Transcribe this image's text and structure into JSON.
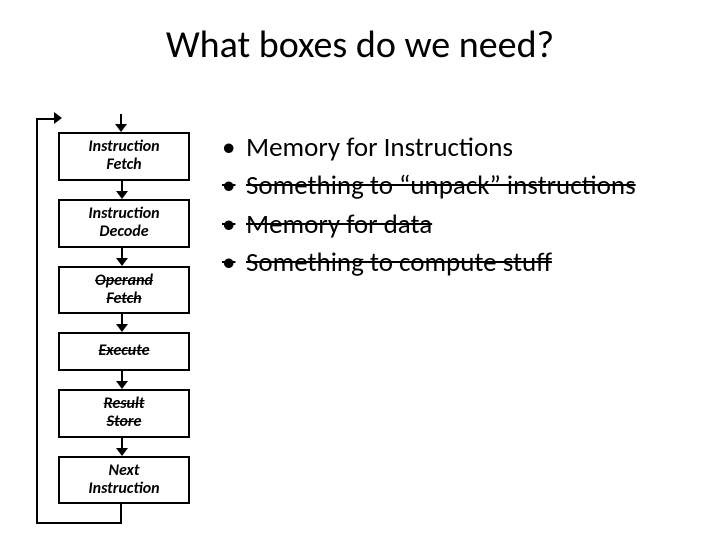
{
  "title": "What boxes do we need?",
  "flow": {
    "stages": [
      {
        "line1": "Instruction",
        "line2": "Fetch",
        "struck": false
      },
      {
        "line1": "Instruction",
        "line2": "Decode",
        "struck": false
      },
      {
        "line1": "Operand",
        "line2": "Fetch",
        "struck": true
      },
      {
        "line1": "Execute",
        "line2": "",
        "struck": true
      },
      {
        "line1": "Result",
        "line2": "Store",
        "struck": true
      },
      {
        "line1": "Next",
        "line2": "Instruction",
        "struck": false
      }
    ]
  },
  "bullets": [
    {
      "text": "Memory for Instructions",
      "struck": false
    },
    {
      "text": "Something to “unpack” instructions",
      "struck": true
    },
    {
      "text": "Memory for data",
      "struck": true
    },
    {
      "text": "Something to compute stuff",
      "struck": true
    }
  ]
}
